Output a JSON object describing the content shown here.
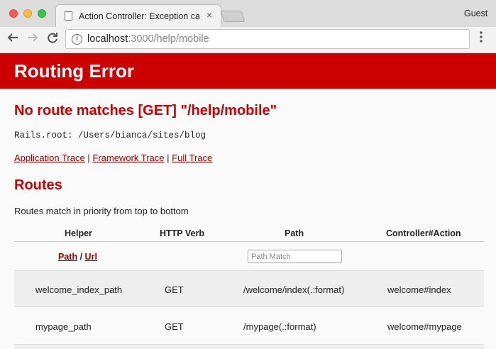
{
  "browser": {
    "tab_title": "Action Controller: Exception caught",
    "tab_close": "×",
    "profile": "Guest",
    "url_host": "localhost",
    "url_rest": ":3000/help/mobile",
    "icons": {
      "back": "arrow-left-icon",
      "forward": "arrow-right-icon",
      "reload": "reload-icon",
      "info": "info-icon",
      "menu": "kebab-menu-icon"
    }
  },
  "page": {
    "error_title": "Routing Error",
    "no_route_heading": "No route matches [GET] \"/help/mobile\"",
    "rails_root": "Rails.root: /Users/bianca/sites/blog",
    "traces": {
      "application": "Application Trace",
      "framework": "Framework Trace",
      "full": "Full Trace",
      "separator": "|"
    },
    "routes_heading": "Routes",
    "routes_description": "Routes match in priority from top to bottom"
  },
  "routes_table": {
    "headers": {
      "helper": "Helper",
      "verb": "HTTP Verb",
      "path": "Path",
      "action": "Controller#Action"
    },
    "path_link": "Path",
    "slash": "/",
    "url_link": "Url",
    "path_match_placeholder": "Path Match",
    "rows": [
      {
        "helper": "welcome_index_path",
        "verb": "GET",
        "path": "/welcome/index(.:format)",
        "action": "welcome#index"
      },
      {
        "helper": "mypage_path",
        "verb": "GET",
        "path": "/mypage(.:format)",
        "action": "welcome#mypage"
      }
    ]
  },
  "colors": {
    "error_red": "#cc0000",
    "heading_red": "#cc0000",
    "link_red": "#990000"
  }
}
